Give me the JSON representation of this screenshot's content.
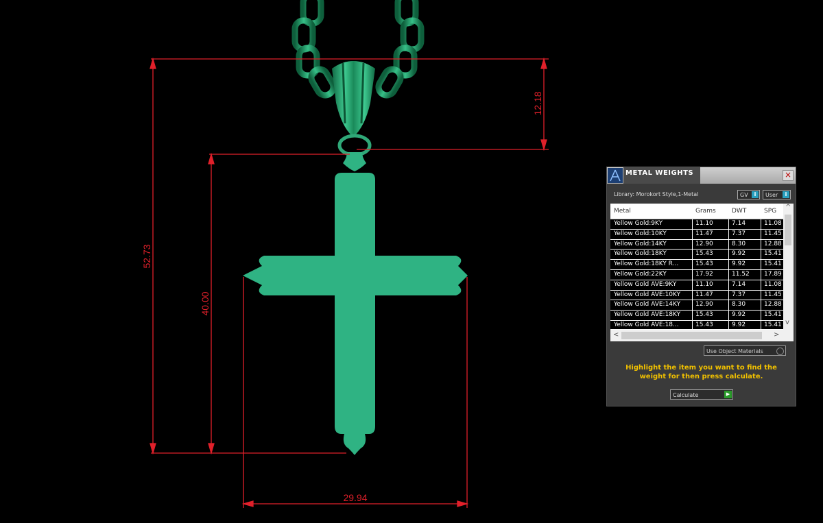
{
  "dimensions": {
    "total_height": "52.73",
    "bail_height": "12.18",
    "cross_height": "40.00",
    "cross_width": "29.94"
  },
  "panel": {
    "title": "METAL WEIGHTS",
    "close_glyph": "×",
    "library_label": "Library: Morokort Style,1-Metal",
    "gv_label": "GV",
    "user_label": "User",
    "info_glyph": "i",
    "columns": [
      "Metal",
      "Grams",
      "DWT",
      "SPG"
    ],
    "rows": [
      [
        "Yellow Gold:9KY",
        "11.10",
        "7.14",
        "11.08"
      ],
      [
        "Yellow Gold:10KY",
        "11.47",
        "7.37",
        "11.45"
      ],
      [
        "Yellow Gold:14KY",
        "12.90",
        "8.30",
        "12.88"
      ],
      [
        "Yellow Gold:18KY",
        "15.43",
        "9.92",
        "15.41"
      ],
      [
        "Yellow Gold:18KY R...",
        "15.43",
        "9.92",
        "15.41"
      ],
      [
        "Yellow Gold:22KY",
        "17.92",
        "11.52",
        "17.89"
      ],
      [
        "Yellow Gold AVE:9KY",
        "11.10",
        "7.14",
        "11.08"
      ],
      [
        "Yellow Gold AVE:10KY",
        "11.47",
        "7.37",
        "11.45"
      ],
      [
        "Yellow Gold AVE:14KY",
        "12.90",
        "8.30",
        "12.88"
      ],
      [
        "Yellow Gold AVE:18KY",
        "15.43",
        "9.92",
        "15.41"
      ],
      [
        "Yellow Gold AVE:18...",
        "15.43",
        "9.92",
        "15.41"
      ]
    ],
    "scroll_up": "^",
    "scroll_down": "v",
    "scroll_left": "<",
    "scroll_right": ">",
    "use_object_materials": "Use Object Materials",
    "instructions": "Highlight the item you want to find the weight for then press calculate.",
    "calculate_label": "Calculate",
    "calculate_icon": "▶",
    "colors": {
      "instruction": "#f0c000",
      "model": "#2fb383",
      "dimension": "#e0202a"
    }
  }
}
